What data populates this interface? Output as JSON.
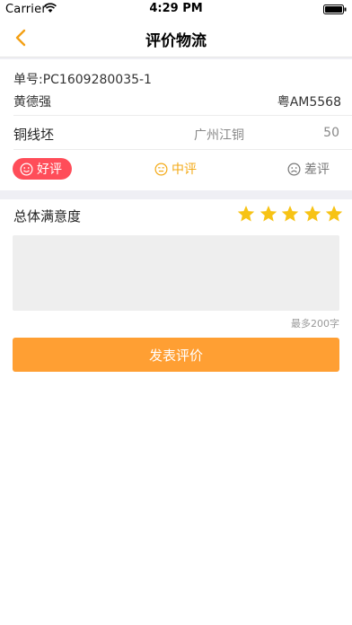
{
  "status_bar": {
    "carrier": "Carrier",
    "time": "4:29 PM"
  },
  "nav": {
    "title": "评价物流"
  },
  "order": {
    "order_no": "单号:PC1609280035-1",
    "driver_name": "黄德强",
    "plate": "粤AM5568",
    "material": "铜线坯",
    "origin": "广州江铜",
    "quantity": "50"
  },
  "ratings": {
    "good": "好评",
    "medium": "中评",
    "bad": "差评",
    "selected": "good"
  },
  "satisfaction": {
    "label": "总体满意度",
    "stars": 5,
    "max_stars": 5
  },
  "comment": {
    "value": "",
    "placeholder": "",
    "limit_text": "最多200字"
  },
  "submit_label": "发表评价",
  "colors": {
    "accent": "#ff9f33",
    "good": "#ff4d59",
    "medium": "#f3a915",
    "star": "#f7c315"
  }
}
